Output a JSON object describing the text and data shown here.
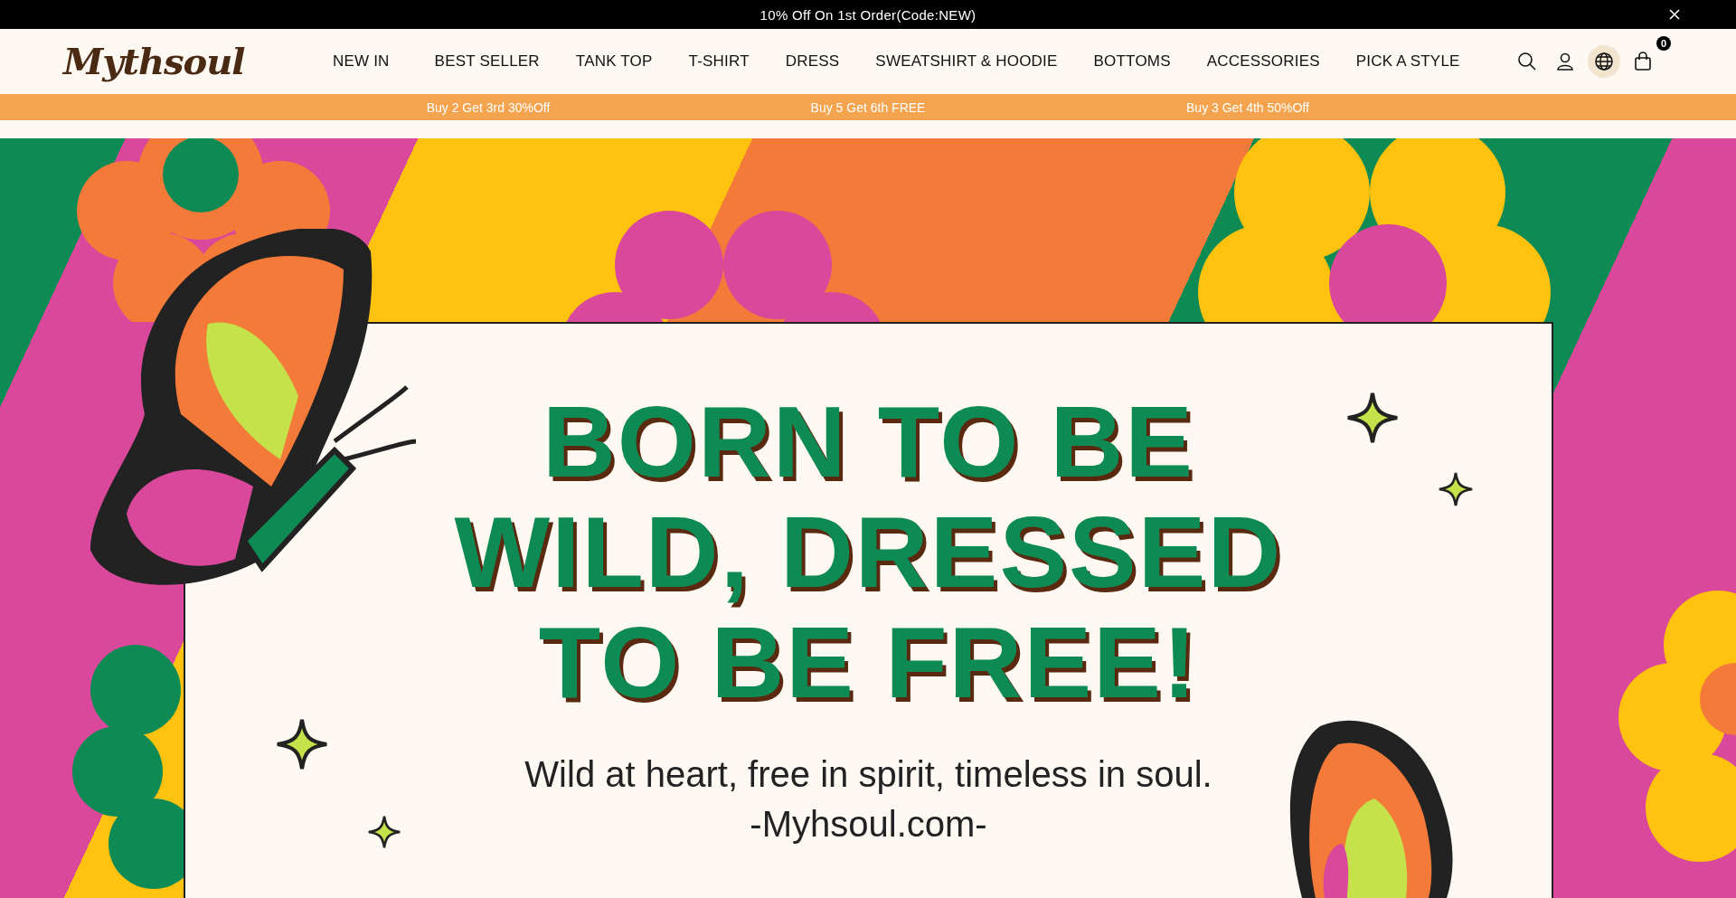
{
  "announcement": {
    "text": "10% Off On 1st Order(Code:NEW)"
  },
  "header": {
    "logo": "Mythsoul",
    "cart_count": "0",
    "nav": [
      "NEW IN",
      "BEST SELLER",
      "TANK TOP",
      "T-SHIRT",
      "DRESS",
      "SWEATSHIRT & HOODIE",
      "BOTTOMS",
      "ACCESSORIES",
      "PICK A STYLE"
    ]
  },
  "promos": [
    "Buy 2 Get 3rd 30%Off",
    "Buy 5 Get 6th FREE",
    "Buy 3 Get 4th 50%Off"
  ],
  "hero": {
    "headline": [
      "BORN TO BE",
      "WILD, DRESSED",
      "TO BE FREE!"
    ],
    "tagline": "Wild at heart, free in spirit, timeless in soul.",
    "signature": "-Myhsoul.com-"
  }
}
